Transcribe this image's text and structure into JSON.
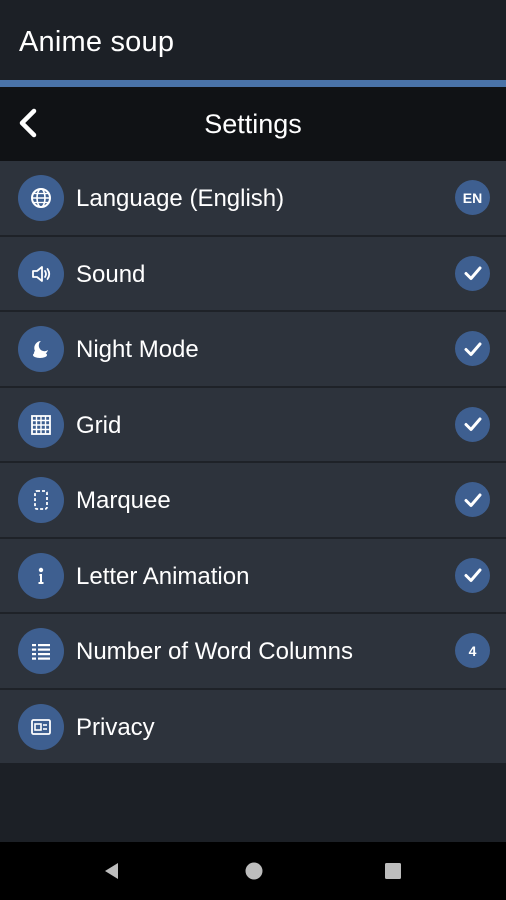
{
  "app": {
    "title": "Anime soup",
    "accent_color": "#4a73a8",
    "icon_circle_color": "#3e5f90"
  },
  "header": {
    "title": "Settings",
    "back_icon": "chevron-left-icon"
  },
  "settings": {
    "items": [
      {
        "label": "Language (English)",
        "icon": "globe-icon",
        "badge": "EN",
        "badge_type": "text"
      },
      {
        "label": "Sound",
        "icon": "speaker-icon",
        "badge_type": "check",
        "checked": true
      },
      {
        "label": "Night Mode",
        "icon": "moon-cloud-icon",
        "badge_type": "check",
        "checked": true
      },
      {
        "label": "Grid",
        "icon": "grid-icon",
        "badge_type": "check",
        "checked": true
      },
      {
        "label": "Marquee",
        "icon": "marquee-icon",
        "badge_type": "check",
        "checked": true
      },
      {
        "label": "Letter Animation",
        "icon": "letter-animation-icon",
        "badge_type": "check",
        "checked": true
      },
      {
        "label": "Number of Word Columns",
        "icon": "columns-icon",
        "badge": "4",
        "badge_type": "text"
      },
      {
        "label": "Privacy",
        "icon": "privacy-icon",
        "badge_type": "none"
      }
    ]
  },
  "navigation": {
    "buttons": [
      "back-triangle-icon",
      "home-circle-icon",
      "recents-square-icon"
    ]
  }
}
